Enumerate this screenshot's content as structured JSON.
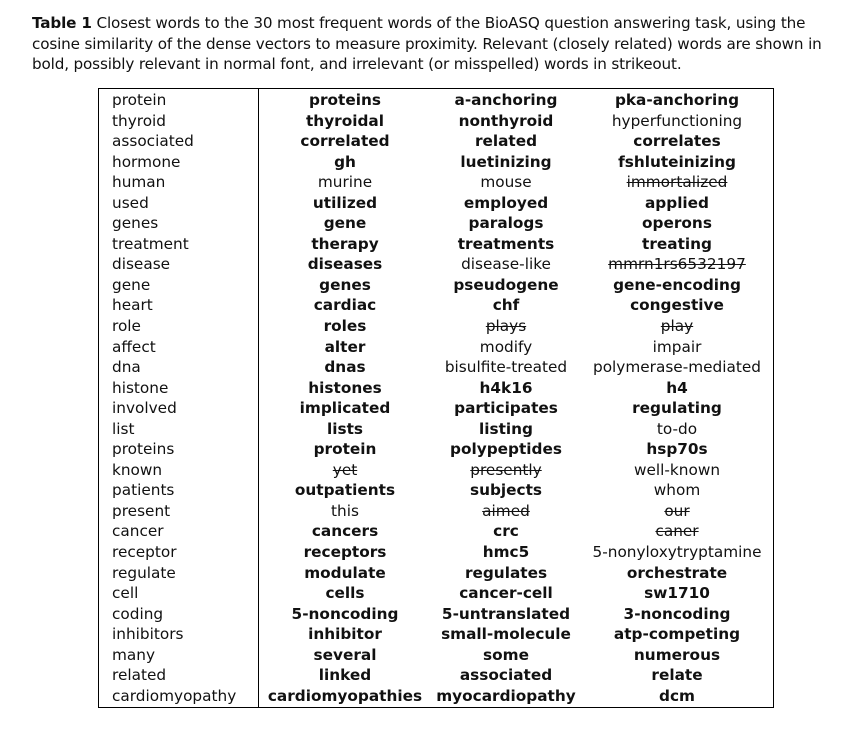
{
  "caption": {
    "label": "Table 1",
    "text": "Closest words to the 30 most frequent words of the BioASQ question answering task, using the cosine similarity of the dense vectors to measure proximity. Relevant (closely related) words are shown in bold, possibly relevant in normal font, and irrelevant (or misspelled) words in strikeout."
  },
  "table": {
    "rows": [
      {
        "word": "protein",
        "neighbors": [
          {
            "w": "proteins",
            "s": "bold"
          },
          {
            "w": "a-anchoring",
            "s": "bold"
          },
          {
            "w": "pka-anchoring",
            "s": "bold"
          }
        ]
      },
      {
        "word": "thyroid",
        "neighbors": [
          {
            "w": "thyroidal",
            "s": "bold"
          },
          {
            "w": "nonthyroid",
            "s": "bold"
          },
          {
            "w": "hyperfunctioning",
            "s": "normal"
          }
        ]
      },
      {
        "word": "associated",
        "neighbors": [
          {
            "w": "correlated",
            "s": "bold"
          },
          {
            "w": "related",
            "s": "bold"
          },
          {
            "w": "correlates",
            "s": "bold"
          }
        ]
      },
      {
        "word": "hormone",
        "neighbors": [
          {
            "w": "gh",
            "s": "bold"
          },
          {
            "w": "luetinizing",
            "s": "bold"
          },
          {
            "w": "fshluteinizing",
            "s": "bold"
          }
        ]
      },
      {
        "word": "human",
        "neighbors": [
          {
            "w": "murine",
            "s": "normal"
          },
          {
            "w": "mouse",
            "s": "normal"
          },
          {
            "w": "immortalized",
            "s": "strike"
          }
        ]
      },
      {
        "word": "used",
        "neighbors": [
          {
            "w": "utilized",
            "s": "bold"
          },
          {
            "w": "employed",
            "s": "bold"
          },
          {
            "w": "applied",
            "s": "bold"
          }
        ]
      },
      {
        "word": "genes",
        "neighbors": [
          {
            "w": "gene",
            "s": "bold"
          },
          {
            "w": "paralogs",
            "s": "bold"
          },
          {
            "w": "operons",
            "s": "bold"
          }
        ]
      },
      {
        "word": "treatment",
        "neighbors": [
          {
            "w": "therapy",
            "s": "bold"
          },
          {
            "w": "treatments",
            "s": "bold"
          },
          {
            "w": "treating",
            "s": "bold"
          }
        ]
      },
      {
        "word": "disease",
        "neighbors": [
          {
            "w": "diseases",
            "s": "bold"
          },
          {
            "w": "disease-like",
            "s": "normal"
          },
          {
            "w": "mmrn1rs6532197",
            "s": "strike"
          }
        ]
      },
      {
        "word": "gene",
        "neighbors": [
          {
            "w": "genes",
            "s": "bold"
          },
          {
            "w": "pseudogene",
            "s": "bold"
          },
          {
            "w": "gene-encoding",
            "s": "bold"
          }
        ]
      },
      {
        "word": "heart",
        "neighbors": [
          {
            "w": "cardiac",
            "s": "bold"
          },
          {
            "w": "chf",
            "s": "bold"
          },
          {
            "w": "congestive",
            "s": "bold"
          }
        ]
      },
      {
        "word": "role",
        "neighbors": [
          {
            "w": "roles",
            "s": "bold"
          },
          {
            "w": "plays",
            "s": "strike"
          },
          {
            "w": "play",
            "s": "strike"
          }
        ]
      },
      {
        "word": "affect",
        "neighbors": [
          {
            "w": "alter",
            "s": "bold"
          },
          {
            "w": "modify",
            "s": "normal"
          },
          {
            "w": "impair",
            "s": "normal"
          }
        ]
      },
      {
        "word": "dna",
        "neighbors": [
          {
            "w": "dnas",
            "s": "bold"
          },
          {
            "w": "bisulfite-treated",
            "s": "normal"
          },
          {
            "w": "polymerase-mediated",
            "s": "normal"
          }
        ]
      },
      {
        "word": "histone",
        "neighbors": [
          {
            "w": "histones",
            "s": "bold"
          },
          {
            "w": "h4k16",
            "s": "bold"
          },
          {
            "w": "h4",
            "s": "bold"
          }
        ]
      },
      {
        "word": "involved",
        "neighbors": [
          {
            "w": "implicated",
            "s": "bold"
          },
          {
            "w": "participates",
            "s": "bold"
          },
          {
            "w": "regulating",
            "s": "bold"
          }
        ]
      },
      {
        "word": "list",
        "neighbors": [
          {
            "w": "lists",
            "s": "bold"
          },
          {
            "w": "listing",
            "s": "bold"
          },
          {
            "w": "to-do",
            "s": "normal"
          }
        ]
      },
      {
        "word": "proteins",
        "neighbors": [
          {
            "w": "protein",
            "s": "bold"
          },
          {
            "w": "polypeptides",
            "s": "bold"
          },
          {
            "w": "hsp70s",
            "s": "bold"
          }
        ]
      },
      {
        "word": "known",
        "neighbors": [
          {
            "w": "yet",
            "s": "strike"
          },
          {
            "w": "presently",
            "s": "strike"
          },
          {
            "w": "well-known",
            "s": "normal"
          }
        ]
      },
      {
        "word": "patients",
        "neighbors": [
          {
            "w": "outpatients",
            "s": "bold"
          },
          {
            "w": "subjects",
            "s": "bold"
          },
          {
            "w": "whom",
            "s": "normal"
          }
        ]
      },
      {
        "word": "present",
        "neighbors": [
          {
            "w": "this",
            "s": "normal"
          },
          {
            "w": "aimed",
            "s": "strike"
          },
          {
            "w": "our",
            "s": "strike"
          }
        ]
      },
      {
        "word": "cancer",
        "neighbors": [
          {
            "w": "cancers",
            "s": "bold"
          },
          {
            "w": "crc",
            "s": "bold"
          },
          {
            "w": "caner",
            "s": "strike"
          }
        ]
      },
      {
        "word": "receptor",
        "neighbors": [
          {
            "w": "receptors",
            "s": "bold"
          },
          {
            "w": "hmc5",
            "s": "bold"
          },
          {
            "w": "5-nonyloxytryptamine",
            "s": "normal"
          }
        ]
      },
      {
        "word": "regulate",
        "neighbors": [
          {
            "w": "modulate",
            "s": "bold"
          },
          {
            "w": "regulates",
            "s": "bold"
          },
          {
            "w": "orchestrate",
            "s": "bold"
          }
        ]
      },
      {
        "word": "cell",
        "neighbors": [
          {
            "w": "cells",
            "s": "bold"
          },
          {
            "w": "cancer-cell",
            "s": "bold"
          },
          {
            "w": "sw1710",
            "s": "bold"
          }
        ]
      },
      {
        "word": "coding",
        "neighbors": [
          {
            "w": "5-noncoding",
            "s": "bold"
          },
          {
            "w": "5-untranslated",
            "s": "bold"
          },
          {
            "w": "3-noncoding",
            "s": "bold"
          }
        ]
      },
      {
        "word": "inhibitors",
        "neighbors": [
          {
            "w": "inhibitor",
            "s": "bold"
          },
          {
            "w": "small-molecule",
            "s": "bold"
          },
          {
            "w": "atp-competing",
            "s": "bold"
          }
        ]
      },
      {
        "word": "many",
        "neighbors": [
          {
            "w": "several",
            "s": "bold"
          },
          {
            "w": "some",
            "s": "bold"
          },
          {
            "w": "numerous",
            "s": "bold"
          }
        ]
      },
      {
        "word": "related",
        "neighbors": [
          {
            "w": "linked",
            "s": "bold"
          },
          {
            "w": "associated",
            "s": "bold"
          },
          {
            "w": "relate",
            "s": "bold"
          }
        ]
      },
      {
        "word": "cardiomyopathy",
        "neighbors": [
          {
            "w": "cardiomyopathies",
            "s": "bold"
          },
          {
            "w": "myocardiopathy",
            "s": "bold"
          },
          {
            "w": "dcm",
            "s": "bold"
          }
        ]
      }
    ]
  }
}
